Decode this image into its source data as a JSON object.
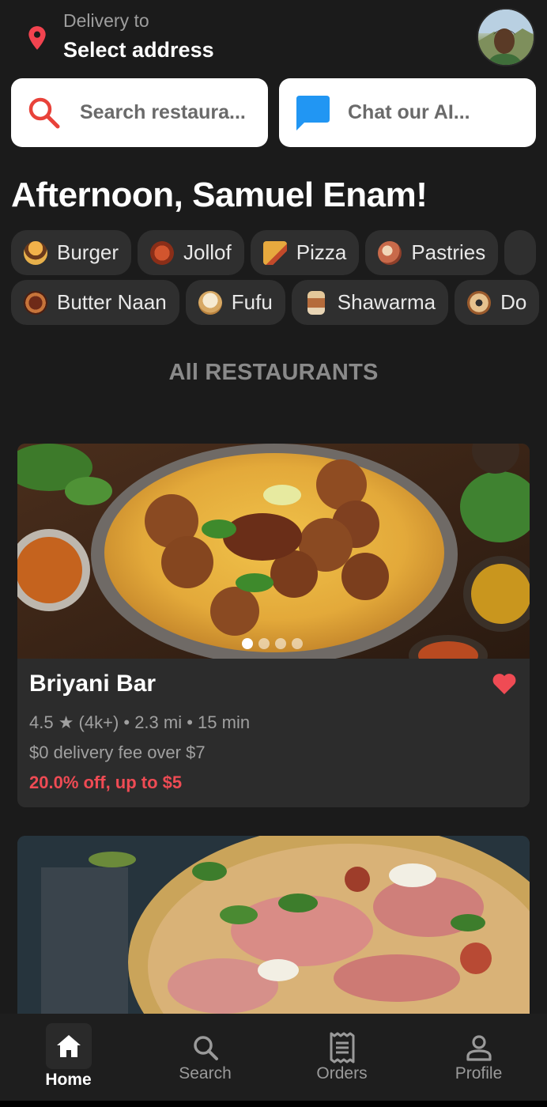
{
  "header": {
    "delivery_label": "Delivery to",
    "address": "Select address"
  },
  "search": {
    "placeholder": "Search restaura..."
  },
  "chat": {
    "placeholder": "Chat our AI..."
  },
  "greeting": "Afternoon, Samuel Enam!",
  "categories_row1": [
    {
      "label": "Burger",
      "icon": "burger-icon",
      "color": "#d9893a"
    },
    {
      "label": "Jollof",
      "icon": "jollof-icon",
      "color": "#c0482b"
    },
    {
      "label": "Pizza",
      "icon": "pizza-icon",
      "color": "#e2a23d"
    },
    {
      "label": "Pastries",
      "icon": "pastries-icon",
      "color": "#c86a4a"
    }
  ],
  "categories_row2": [
    {
      "label": "Butter Naan",
      "icon": "butter-naan-icon",
      "color": "#8a3a22"
    },
    {
      "label": "Fufu",
      "icon": "fufu-icon",
      "color": "#e9d6b3"
    },
    {
      "label": "Shawarma",
      "icon": "shawarma-icon",
      "color": "#b56b3b"
    },
    {
      "label": "Do",
      "icon": "donut-icon",
      "color": "#c7905a"
    }
  ],
  "section_title": "All RESTAURANTS",
  "restaurant": {
    "name": "Briyani Bar",
    "meta": "4.5 ★ (4k+) • 2.3 mi • 15 min",
    "delivery": "$0 delivery fee over $7",
    "promo": "20.0% off, up to $5",
    "image_count": 4,
    "active_image": 1,
    "favorited": true
  },
  "nav": {
    "home": "Home",
    "search": "Search",
    "orders": "Orders",
    "profile": "Profile",
    "active": "home"
  },
  "colors": {
    "background": "#1b1b1b",
    "accent_red": "#ef4b54",
    "chat_blue": "#2196f3",
    "chip_bg": "#2f2f2f"
  }
}
